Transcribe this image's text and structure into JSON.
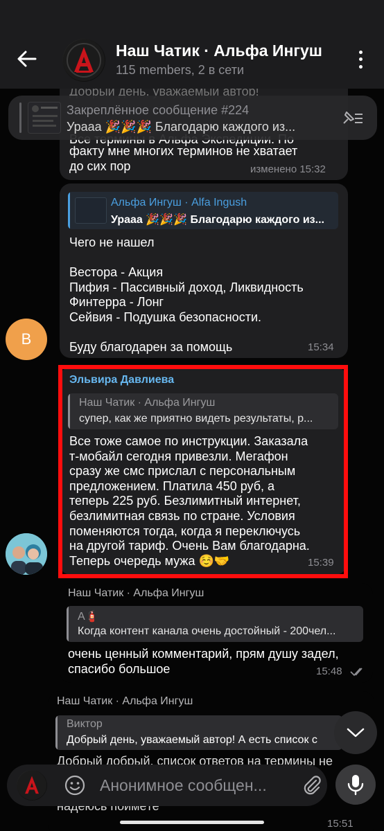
{
  "header": {
    "title": "Наш Чатик · Альфа Ингуш",
    "subtitle": "115 members, 2 в сети",
    "avatar_letter": "A"
  },
  "pinned": {
    "title": "Закреплённое сообщение #224",
    "text": "Урааа 🎉🎉🎉  Благодарю каждого из..."
  },
  "messages": [
    {
      "text_under_header": "Добрый день, уважаемый автор!",
      "partial_line": "Все термины в Альфа Экспедиции. По",
      "text": "факту мне многих терминов не хватает\nдо сих пор",
      "time": "изменено 15:32"
    },
    {
      "quote_author": "Альфа Ингуш · Alfa Ingush",
      "quote_text": "Урааа 🎉🎉🎉  Благодарю каждого из...",
      "text": "Чего не нашел\n\nВестора - Акция\nПифия - Пассивный доход, Ликвидность\nФинтерра - Лонг\nСейвия - Подушка безопасности.\n\nБуду благодарен за помощь",
      "time": "15:34",
      "avatar_letter": "В"
    },
    {
      "sender": "Эльвира Давлиева",
      "quote_author": "Наш Чатик · Альфа Ингуш",
      "quote_text": "супер, как же приятно видеть результаты, р...",
      "text": "Все тоже самое по инструкции. Заказала\nт-мобайл сегодня привезли. Мегафон\nсразу же смс прислал с персональным\nпредложением. Платила 450 руб, а\nтеперь 225 руб. Безлимитный интернет,\nбезлимитная связь по стране. Условия\nпоменяются тогда, когда я переключусь\nна другой тариф. Очень Вам благодарна.\nТеперь очередь мужа ☺️🤝",
      "time": "15:39"
    },
    {
      "sender": "Наш Чатик · Альфа Ингуш",
      "quote_author": "А🧯",
      "quote_text": "Когда контент канала очень достойный - 200чел...",
      "text": "очень ценный комментарий, прям душу задел,\nспасибо большое",
      "time": "15:48"
    },
    {
      "sender": "Наш Чатик · Альфа Ингуш",
      "quote_author": "Виктор",
      "quote_text": "Добрый день, уважаемый автор!  А есть список с",
      "text": "Добрый добрый, список ответов на термины не\nуспела сделать, возможно, пока сегодня\nвремя на эту игру, очень много дел, постов,\nнадеюсь поймёте",
      "time": "15:51"
    }
  ],
  "input": {
    "placeholder": "Анонимное сообщен..."
  },
  "colors": {
    "accent": "#67b7ef",
    "highlight_border": "#ff0d0d",
    "bubble": "#1f1f21",
    "avatar_orange": "#f0a04b"
  }
}
